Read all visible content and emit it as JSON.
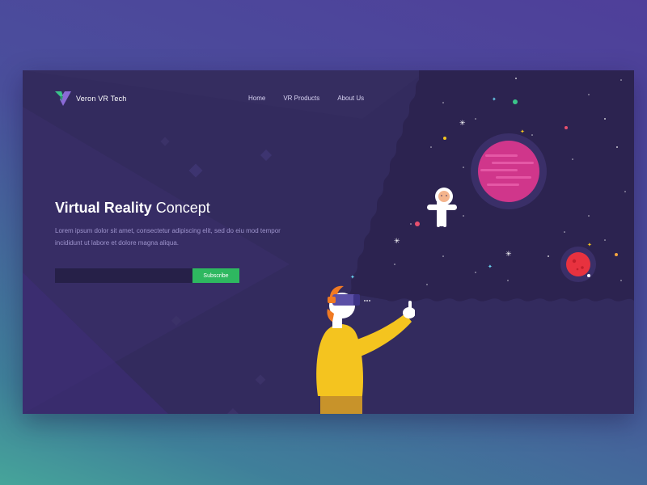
{
  "brand": {
    "name": "Veron VR Tech",
    "logo_icon": "v-logo-icon",
    "colors": {
      "logo_green": "#3bc48a",
      "logo_purple": "#8a6ad6",
      "card_background": "#332b5e",
      "space_background": "#2c2350",
      "accent_green": "#2eb860",
      "planet_pink": "#d0368b",
      "planet_red": "#e8323f",
      "sweater_yellow": "#f4c41f"
    }
  },
  "nav": {
    "items": [
      {
        "label": "Home"
      },
      {
        "label": "VR Products"
      },
      {
        "label": "About Us"
      }
    ]
  },
  "hero": {
    "title_bold": "Virtual Reality",
    "title_light": "Concept",
    "description": "Lorem ipsum dolor sit amet, consectetur adipiscing elit, sed do eiu mod tempor incididunt ut labore et dolore magna aliqua."
  },
  "subscribe": {
    "input_value": "",
    "placeholder": "",
    "button_label": "Subscribe"
  }
}
